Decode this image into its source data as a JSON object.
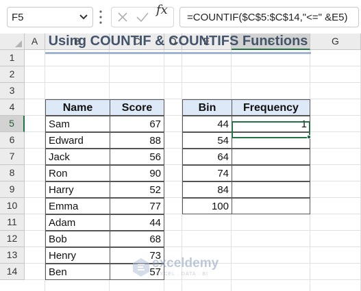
{
  "name_box": "F5",
  "formula": "=COUNTIF($C$5:$C$14,\"<=\" &E5)",
  "fx_label": "fx",
  "columns": [
    "A",
    "B",
    "C",
    "D",
    "E",
    "F",
    "G"
  ],
  "selected_column": "F",
  "rows": [
    "1",
    "2",
    "3",
    "4",
    "5",
    "6",
    "7",
    "8",
    "9",
    "10",
    "11",
    "12",
    "13",
    "14"
  ],
  "selected_row": "5",
  "title": "Using COUNTIF & COUNTIFS Functions",
  "scores_table": {
    "headers": [
      "Name",
      "Score"
    ],
    "rows": [
      {
        "name": "Sam",
        "score": "67"
      },
      {
        "name": "Edward",
        "score": "88"
      },
      {
        "name": "Jack",
        "score": "56"
      },
      {
        "name": "Ron",
        "score": "90"
      },
      {
        "name": "Harry",
        "score": "52"
      },
      {
        "name": "Emma",
        "score": "77"
      },
      {
        "name": "Adam",
        "score": "44"
      },
      {
        "name": "Bob",
        "score": "68"
      },
      {
        "name": "Henry",
        "score": "73"
      },
      {
        "name": "Ben",
        "score": "57"
      }
    ]
  },
  "bins_table": {
    "headers": [
      "Bin",
      "Frequency"
    ],
    "rows": [
      {
        "bin": "44",
        "frequency": "1"
      },
      {
        "bin": "54",
        "frequency": ""
      },
      {
        "bin": "64",
        "frequency": ""
      },
      {
        "bin": "74",
        "frequency": ""
      },
      {
        "bin": "84",
        "frequency": ""
      },
      {
        "bin": "100",
        "frequency": ""
      }
    ]
  },
  "watermark": {
    "name": "exceldemy",
    "tagline": "EXCEL · DATA · BI"
  },
  "colors": {
    "accent": "#217346",
    "header_fill": "#dde9f7",
    "title": "#44546a"
  }
}
